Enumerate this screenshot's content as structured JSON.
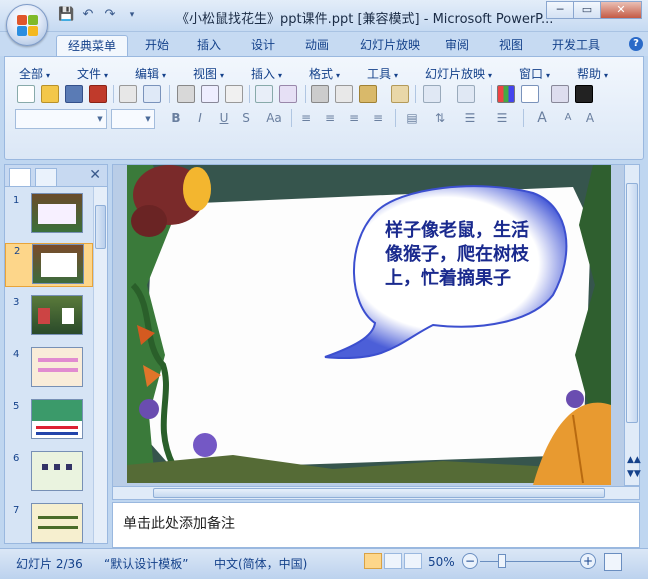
{
  "window": {
    "title": "《小松鼠找花生》ppt课件.ppt [兼容模式] - Microsoft PowerP...",
    "minimize_label": "─",
    "restore_label": "▭",
    "close_label": "✕"
  },
  "quick_access": [
    "save-icon",
    "undo-icon",
    "redo-icon",
    "customize-icon"
  ],
  "ribbon_tabs": [
    "经典菜单",
    "开始",
    "插入",
    "设计",
    "动画",
    "幻灯片放映",
    "审阅",
    "视图",
    "开发工具"
  ],
  "active_tab": "经典菜单",
  "menus": [
    "全部",
    "文件",
    "编辑",
    "视图",
    "插入",
    "格式",
    "工具",
    "幻灯片放映",
    "窗口",
    "帮助"
  ],
  "slides": [
    {
      "number": "1"
    },
    {
      "number": "2"
    },
    {
      "number": "3"
    },
    {
      "number": "4"
    },
    {
      "number": "5"
    },
    {
      "number": "6"
    },
    {
      "number": "7"
    }
  ],
  "selected_slide": "2",
  "slide_content": {
    "speech_bubble_text": "样子像老鼠，生活像猴子，爬在树枝上，忙着摘果子"
  },
  "notes_placeholder": "单击此处添加备注",
  "status": {
    "slide_info": "幻灯片 2/36",
    "template": "“默认设计模板”",
    "language": "中文(简体，中国)",
    "zoom": "50%"
  },
  "colors": {
    "accent": "#15428b",
    "ribbon_bg": "#dbe7f6",
    "selection": "#fdd68a",
    "speech_text": "#1a2a8e"
  }
}
